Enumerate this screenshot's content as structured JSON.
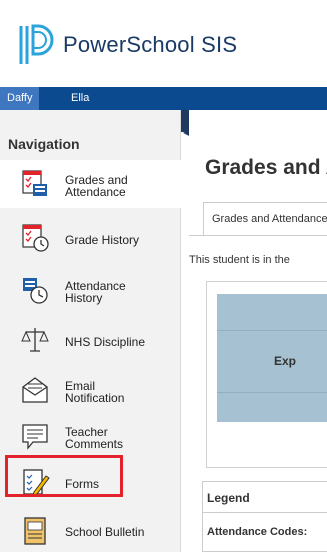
{
  "header": {
    "brand": "PowerSchool SIS"
  },
  "student_bar": {
    "tabs": [
      "Daffy",
      "Ella"
    ]
  },
  "sidebar": {
    "title": "Navigation",
    "items": [
      {
        "label_line1": "Grades and",
        "label_line2": "Attendance",
        "icon": "grades-attendance-icon",
        "active": true
      },
      {
        "label_line1": "Grade History",
        "label_line2": "",
        "icon": "grade-history-icon",
        "active": false
      },
      {
        "label_line1": "Attendance",
        "label_line2": "History",
        "icon": "attendance-history-icon",
        "active": false
      },
      {
        "label_line1": "NHS Discipline",
        "label_line2": "",
        "icon": "scales-icon",
        "active": false
      },
      {
        "label_line1": "Email",
        "label_line2": "Notification",
        "icon": "email-icon",
        "active": false
      },
      {
        "label_line1": "Teacher",
        "label_line2": "Comments",
        "icon": "comment-icon",
        "active": false
      },
      {
        "label_line1": "Forms",
        "label_line2": "",
        "icon": "forms-icon",
        "active": false
      },
      {
        "label_line1": "School Bulletin",
        "label_line2": "",
        "icon": "bulletin-icon",
        "active": false
      }
    ]
  },
  "content": {
    "page_title": "Grades and Attendance",
    "tab_label": "Grades and Attendance",
    "notice": "This student is in the",
    "grid_header": "Exp",
    "legend_title": "Legend",
    "legend_codes": "Attendance Codes:"
  },
  "colors": {
    "brand_blue": "#0b4a8f",
    "active_tab": "#3e76c0",
    "highlight_red": "#e2232a",
    "grid_blue": "#a6c2d2"
  }
}
